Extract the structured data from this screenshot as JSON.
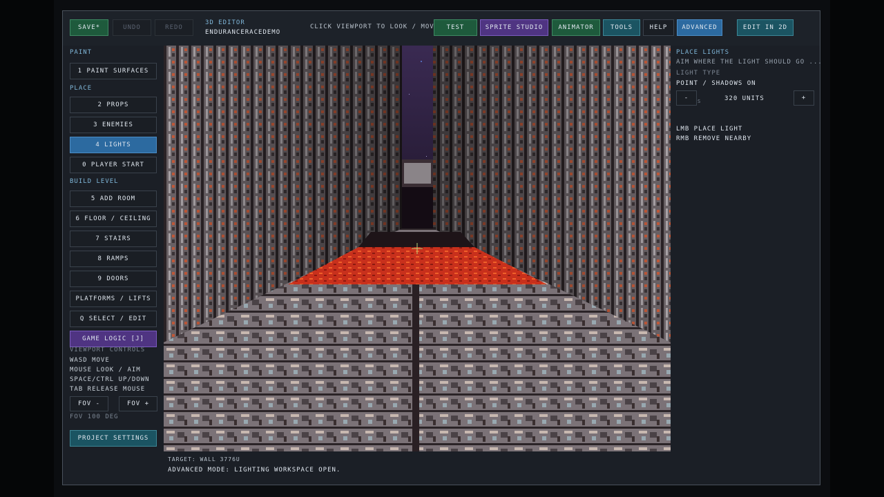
{
  "toolbar": {
    "save": "SAVE*",
    "undo": "UNDO",
    "redo": "REDO",
    "mode_title": "3D EDITOR",
    "project_name": "ENDURANCERACEDEMO",
    "hint": "CLICK VIEWPORT TO LOOK / MOVE",
    "test": "TEST",
    "sprite_studio": "SPRITE STUDIO",
    "animator": "ANIMATOR",
    "tools": "TOOLS",
    "help": "HELP",
    "advanced": "ADVANCED",
    "edit_2d": "EDIT IN 2D"
  },
  "sidebar": {
    "section_paint": "PAINT",
    "paint_surfaces": "1  PAINT SURFACES",
    "section_place": "PLACE",
    "props": "2  PROPS",
    "enemies": "3  ENEMIES",
    "lights": "4  LIGHTS",
    "player_start": "0  PLAYER START",
    "section_build": "BUILD LEVEL",
    "add_room": "5  ADD ROOM",
    "floor_ceiling": "6  FLOOR / CEILING",
    "stairs": "7  STAIRS",
    "ramps": "8  RAMPS",
    "doors": "9  DOORS",
    "platforms_lifts": "PLATFORMS / LIFTS",
    "select_edit": "Q  SELECT / EDIT",
    "game_logic": "GAME LOGIC [J]",
    "controls_title": "VIEWPORT CONTROLS",
    "ctrl_wasd": "WASD  MOVE",
    "ctrl_mouse": "MOUSE  LOOK / AIM",
    "ctrl_space": "SPACE/CTRL  UP/DOWN",
    "ctrl_tab": "TAB  RELEASE MOUSE",
    "fov_minus": "FOV -",
    "fov_plus": "FOV +",
    "fov_value": "FOV 100 DEG",
    "project_settings": "PROJECT SETTINGS"
  },
  "panel": {
    "title": "PLACE LIGHTS",
    "instruction": "AIM WHERE THE LIGHT SHOULD GO ...",
    "light_type_label": "LIGHT TYPE",
    "light_type_value": "POINT / SHADOWS ON",
    "minus": "-",
    "plus": "+",
    "radius_value": "320 UNITS",
    "radius_hint": "S",
    "lmb": "LMB  PLACE LIGHT",
    "rmb": "RMB  REMOVE NEARBY"
  },
  "status": {
    "target": "TARGET: WALL  3776U",
    "message": "ADVANCED MODE: LIGHTING WORKSPACE OPEN."
  },
  "colors": {
    "accent_blue": "#2c6aa0",
    "green": "#1e5a3c",
    "purple": "#4f3482",
    "teal": "#1b5462",
    "lava": "#c8301c"
  }
}
